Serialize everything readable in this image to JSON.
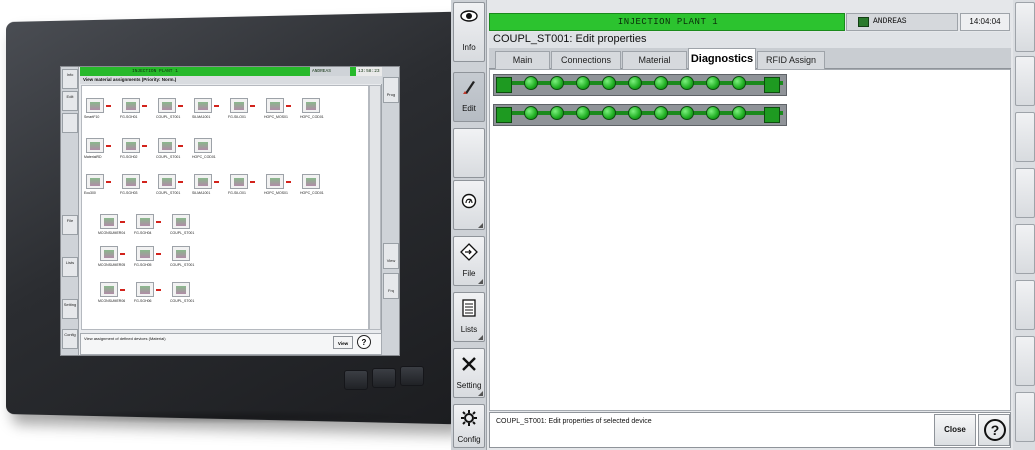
{
  "hmi": {
    "plant_title": "INJECTION PLANT 1",
    "user": "ANDREAS",
    "time": "14:04:04",
    "heading": "COUPL_ST001: Edit properties",
    "tabs": [
      "Main",
      "Connections",
      "Material",
      "Diagnostics",
      "RFID Assign"
    ],
    "active_tab": "Diagnostics",
    "sidebar": [
      {
        "label": "Info",
        "icon": "eye-icon"
      },
      {
        "label": "Edit",
        "icon": "pencil-icon"
      },
      {
        "label": "",
        "icon": "blank"
      },
      {
        "label": "",
        "icon": "gauge-icon"
      },
      {
        "label": "File",
        "icon": "file-icon"
      },
      {
        "label": "Lists",
        "icon": "list-icon"
      },
      {
        "label": "Setting",
        "icon": "tools-icon"
      },
      {
        "label": "Config",
        "icon": "config-icon"
      }
    ],
    "status_message": "COUPL_ST001: Edit properties of selected device",
    "close_label": "Close",
    "help_label": "?"
  },
  "monitor_screen": {
    "plant_title": "INJECTION PLANT 1",
    "user": "ANDREAS",
    "time": "13:58:23",
    "heading": "View material assignments (Priority: Norm.)",
    "sidebar": [
      "Info",
      "Edit",
      "",
      "File",
      "Lists",
      "Setting",
      "Config"
    ],
    "rightbar": [
      "Prog",
      "View",
      "Frq"
    ],
    "status_message": "View assignment of defined devices (Material)",
    "close_label": "View",
    "help_label": "?",
    "rows": [
      [
        "SmartF10",
        "FG-SGH01",
        "COUPL_ST001",
        "SILMA1001",
        "FG-SILO01",
        "HOPC_MOS01",
        "HOPC_COD01"
      ],
      [
        "MaterialRD",
        "FG-SGH02",
        "COUPL_ST001",
        "HOPC_COD01"
      ],
      [
        "Ecu300",
        "FG-SGH03",
        "COUPL_ST001",
        "SILMA1001",
        "FG-SILO01",
        "HOPC_MOS01",
        "HOPC_COD01"
      ],
      [
        "MCONSUMER04",
        "FG-SGH04",
        "COUPL_ST001"
      ],
      [
        "MCONSUMER05",
        "FG-SGH05",
        "COUPL_ST001"
      ],
      [
        "MCONSUMER06",
        "FG-SGH06",
        "COUPL_ST001"
      ]
    ]
  }
}
